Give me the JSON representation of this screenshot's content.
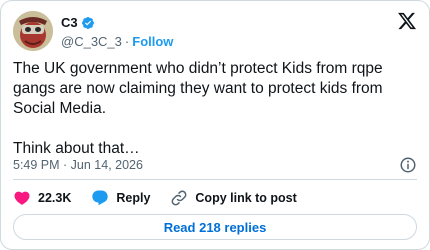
{
  "author": {
    "display_name": "C3",
    "handle": "@C_3C_3",
    "separator": "·",
    "follow_label": "Follow"
  },
  "tweet": {
    "paragraph1": "The UK government who didn’t protect Kids from rqpe gangs are now claiming they want to protect kids from Social Media.",
    "paragraph2": "Think about that…",
    "timestamp": "5:49 PM · Jun 14, 2026"
  },
  "actions": {
    "likes_count": "22.3K",
    "reply_label": "Reply",
    "copy_link_label": "Copy link to post"
  },
  "read_replies_label": "Read 218 replies",
  "icons": [
    "verified-icon",
    "x-logo-icon",
    "info-icon",
    "heart-icon",
    "reply-icon",
    "link-icon"
  ],
  "colors": {
    "accent": "#1d9bf0",
    "like": "#f91880",
    "text": "#0f1419",
    "muted": "#536471",
    "border": "#cfd9de"
  }
}
